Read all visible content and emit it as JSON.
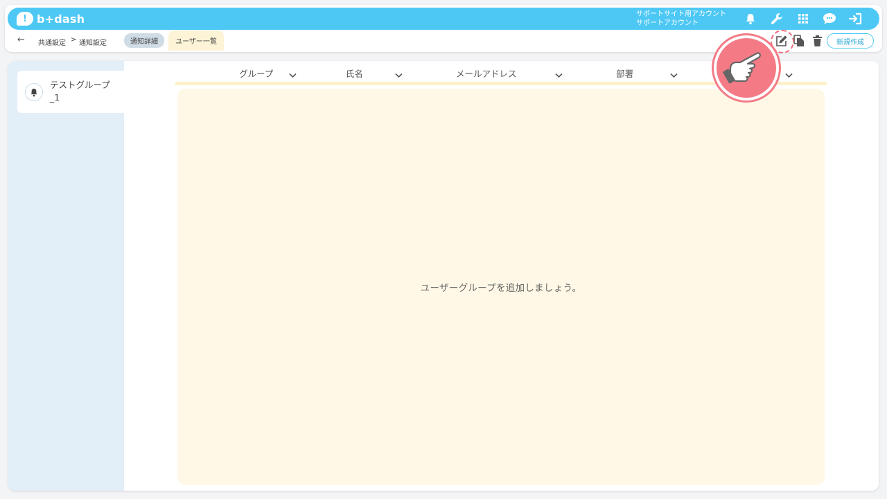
{
  "app": {
    "logo_text": "b+dash",
    "logo_mark": "!"
  },
  "account": {
    "line1": "サポートサイト用アカウント",
    "line2": "サポートアカウント"
  },
  "top_icons": [
    "bell-icon",
    "wrench-icon",
    "apps-grid-icon",
    "chat-icon",
    "logout-icon"
  ],
  "breadcrumb": {
    "items": [
      "共通設定",
      "通知設定"
    ],
    "separator": ">"
  },
  "tabs": [
    {
      "label": "通知詳細",
      "active": false
    },
    {
      "label": "ユーザー一覧",
      "active": true
    }
  ],
  "toolbar": {
    "icons": [
      "edit-icon",
      "copy-icon",
      "trash-icon"
    ],
    "new_button": "新規作成"
  },
  "sidebar": {
    "groups": [
      {
        "label": "テストグループ_1",
        "icon": "bell-icon"
      }
    ]
  },
  "table": {
    "columns": [
      "グループ",
      "氏名",
      "メールアドレス",
      "部署"
    ],
    "empty_message": "ユーザーグループを追加しましょう。"
  },
  "colors": {
    "brand": "#4dc8f5",
    "tab_active": "#fdf3d6",
    "tab_inactive": "#cfdbe5",
    "highlight": "#f47b86"
  }
}
